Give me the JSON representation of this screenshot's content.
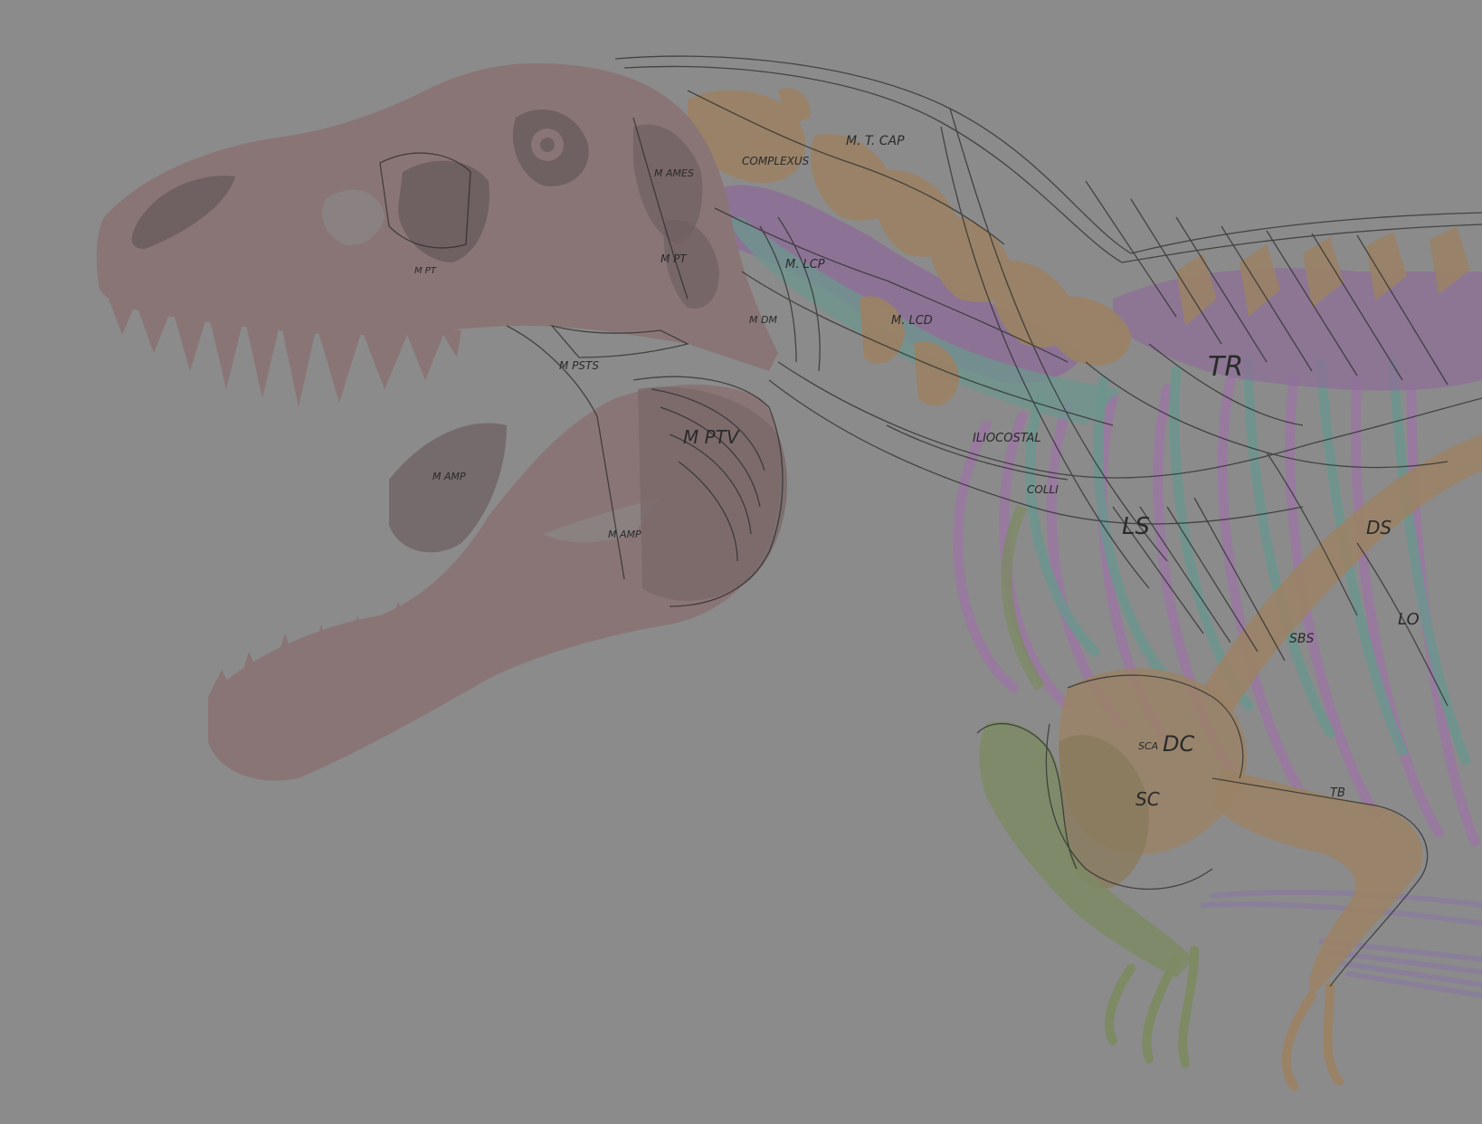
{
  "colors": {
    "background": "#8b8b8b",
    "skull": "#8a7576",
    "skull_dark": "#6f6061",
    "bone": "#9a8266",
    "muscle_purple": "#8c6f97",
    "muscle_teal": "#6c968e",
    "rib_purple": "#9a78a2",
    "leg_green": "#7d8a64",
    "sketch_line": "#2b2b2b"
  },
  "labels": {
    "m_t_cap": "M. T. CAP",
    "complexus": "COMPLEXUS",
    "m_lcp": "M. LCP",
    "m_lcd": "M. LCD",
    "iliocostalis": "ILIOCOSTAL",
    "colli": "COLLI",
    "tr": "TR",
    "ls": "LS",
    "ds": "DS",
    "lo": "LO",
    "dc": "DC",
    "sca": "SCA",
    "sc": "SC",
    "sbs": "SBS",
    "tb": "TB",
    "m_ptv": "M PTV",
    "m_amp": "M AMP",
    "m_ames": "M AMES",
    "m_pt": "M PT",
    "m_psts": "M PSTS",
    "m_pt_jaw": "M PT",
    "m_dm": "M DM",
    "m_amp_jaw": "M AMP"
  }
}
